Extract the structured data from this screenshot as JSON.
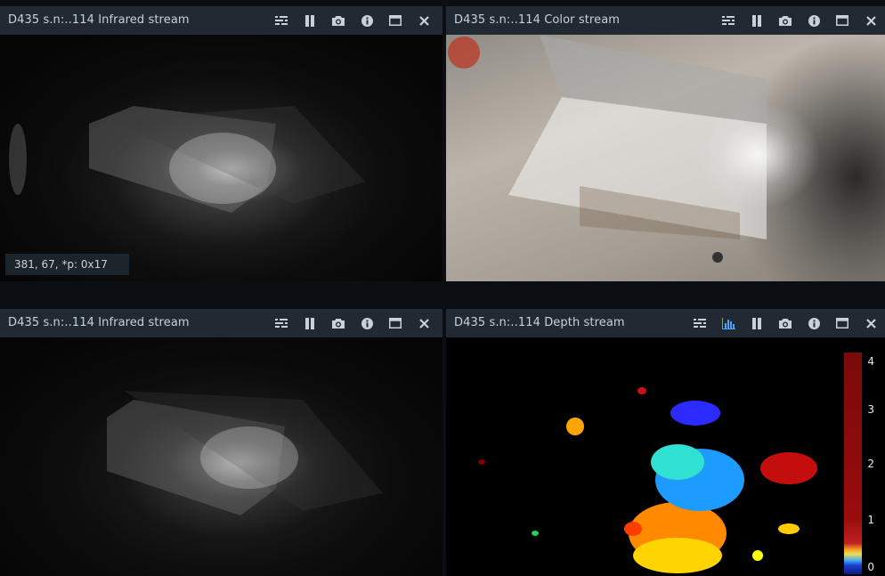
{
  "panels": [
    {
      "title": "D435 s.n:..114 Infrared stream"
    },
    {
      "title": "D435 s.n:..114 Color stream"
    },
    {
      "title": "D435 s.n:..114 Infrared stream"
    },
    {
      "title": "D435 s.n:..114 Depth stream"
    }
  ],
  "readout": "381, 67, *p: 0x17",
  "depth_scale": {
    "labels": [
      "4",
      "3",
      "2",
      "1",
      "0"
    ]
  },
  "icons": [
    "controls-icon",
    "histogram-icon",
    "pause-icon",
    "camera-icon",
    "info-icon",
    "maximize-icon",
    "close-icon"
  ],
  "colors": {
    "title_bar": "#212a33",
    "background": "#0b0e12",
    "histogram_icon": "#4aa3ff"
  }
}
